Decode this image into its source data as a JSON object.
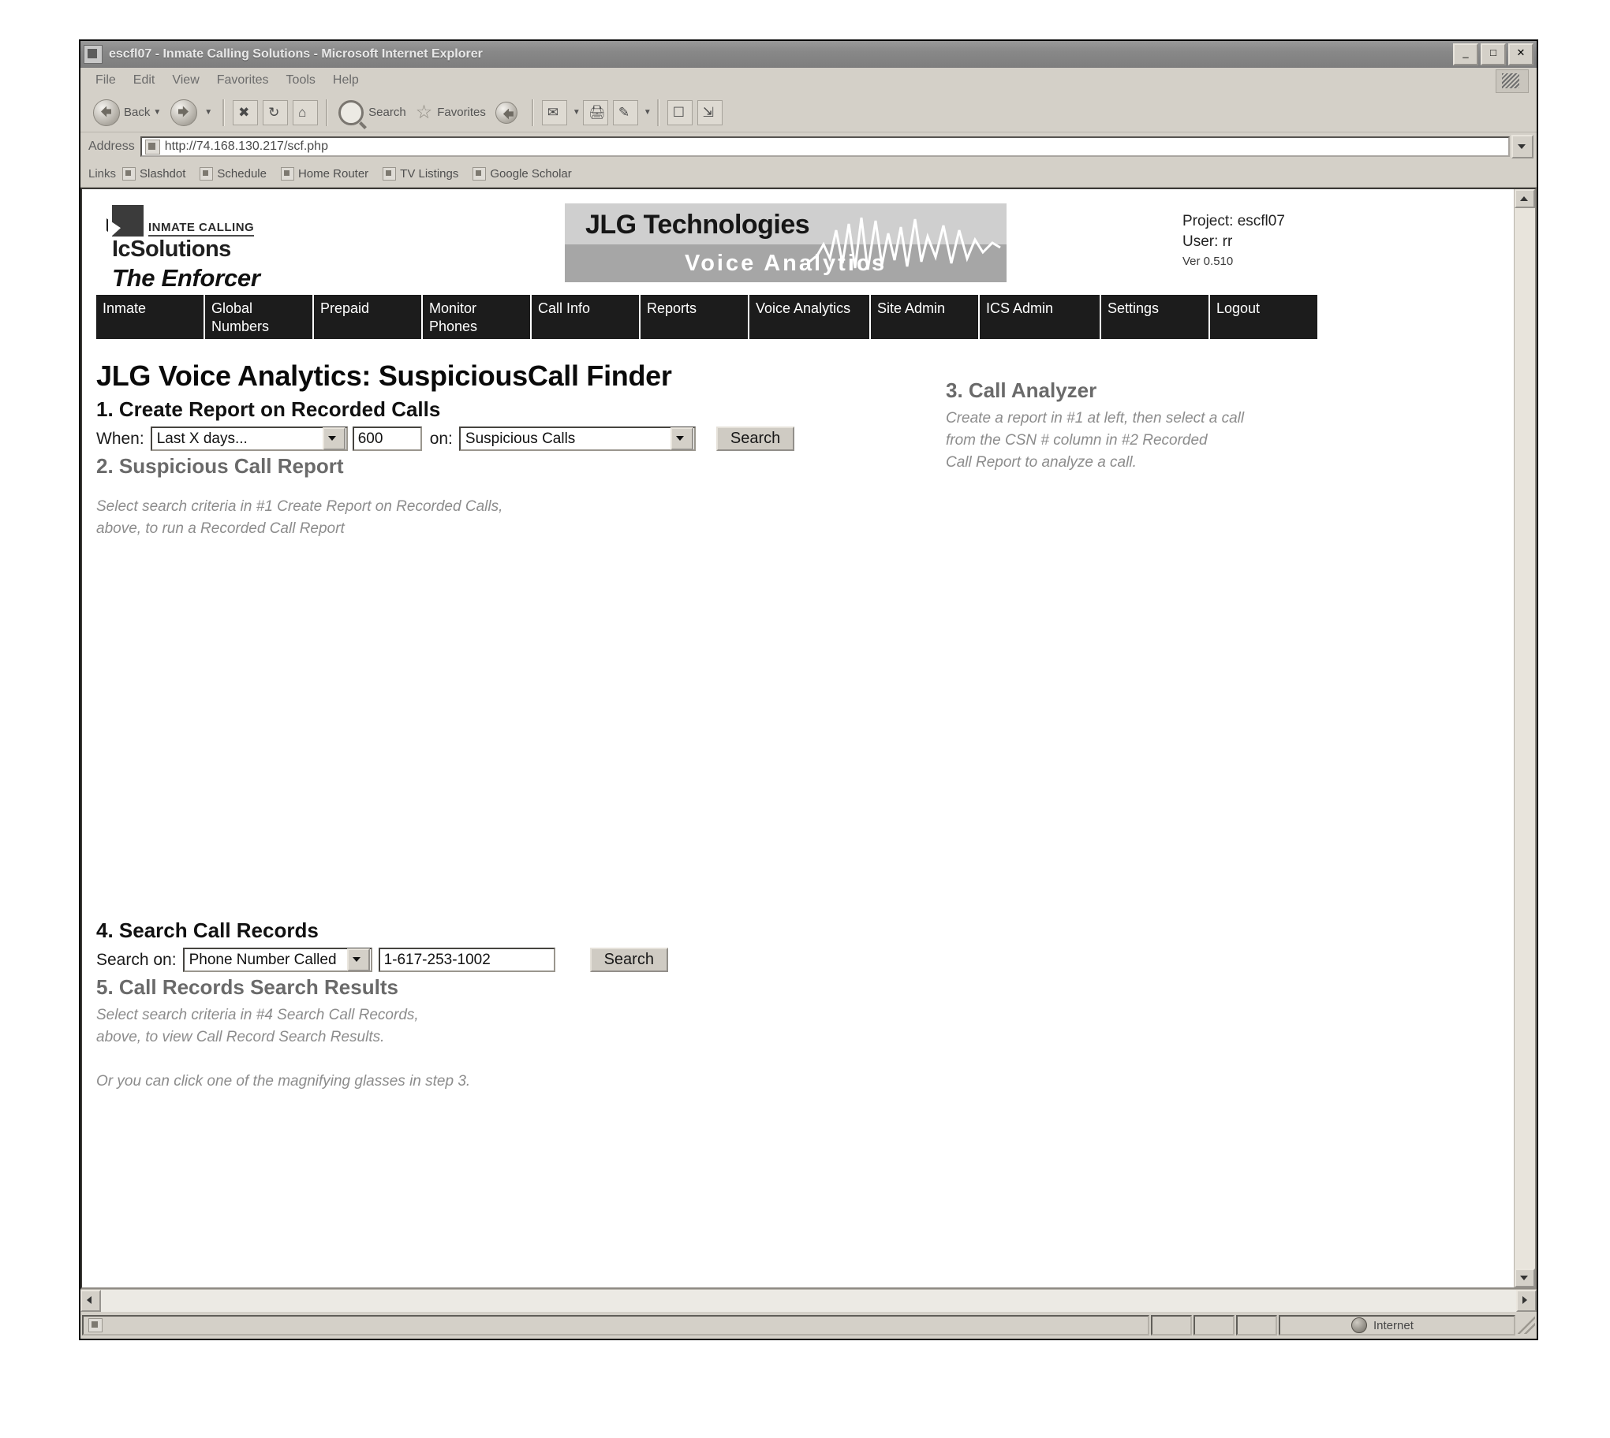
{
  "window": {
    "title": "escfl07 - Inmate Calling Solutions - Microsoft Internet Explorer",
    "minimize_label": "_",
    "maximize_label": "□",
    "close_label": "✕"
  },
  "menubar": {
    "items": [
      "File",
      "Edit",
      "View",
      "Favorites",
      "Tools",
      "Help"
    ]
  },
  "toolbar": {
    "back_label": "Back",
    "forward_label": "",
    "search_label": "Search",
    "favorites_label": "Favorites"
  },
  "address": {
    "label": "Address",
    "value": "http://74.168.130.217/scf.php"
  },
  "links": {
    "label": "Links",
    "items": [
      "Slashdot",
      "Schedule",
      "Home Router",
      "TV Listings",
      "Google Scholar"
    ]
  },
  "brand": {
    "inmate_calling": "INMATE CALLING",
    "ics_solutions": "IcSolutions",
    "enforcer": "The Enforcer"
  },
  "banner": {
    "title_prefix": "JLG",
    "title_suffix": "Technologies",
    "subtitle": "Voice Analytics"
  },
  "project": {
    "project_line": "Project: escfl07",
    "user_line": "User: rr",
    "version_line": "Ver 0.510"
  },
  "nav": {
    "items": [
      "Inmate",
      "Global Numbers",
      "Prepaid",
      "Monitor Phones",
      "Call Info",
      "Reports",
      "Voice Analytics",
      "Site Admin",
      "ICS Admin",
      "Settings",
      "Logout"
    ]
  },
  "page": {
    "heading_prefix": "JLG Voice Analytics: ",
    "heading_strong": "SuspiciousCall Finder",
    "section1": {
      "title": "1. Create Report on Recorded Calls",
      "when_label": "When:",
      "when_value": "Last X days...",
      "days_value": "600",
      "on_label": "on:",
      "on_value": "Suspicious Calls",
      "search_label": "Search"
    },
    "section2": {
      "title": "2. Suspicious Call Report",
      "note_line1": "Select search criteria in #1 Create Report on Recorded Calls,",
      "note_line2": "above, to run a Recorded Call Report"
    },
    "section3": {
      "title": "3. Call Analyzer",
      "note_line1": "Create a report in #1 at left, then select a call",
      "note_line2": "from the CSN # column in #2 Recorded",
      "note_line3": "Call Report to analyze a call."
    },
    "section4": {
      "title": "4. Search Call Records",
      "search_on_label": "Search on:",
      "search_on_value": "Phone Number Called",
      "query_value": "1-617-253-1002",
      "search_label": "Search"
    },
    "section5": {
      "title": "5. Call Records Search Results",
      "note_line1": "Select search criteria in #4 Search Call Records,",
      "note_line2": "above, to view Call Record Search Results.",
      "note_line3": "Or you can click one of the magnifying glasses in step 3."
    }
  },
  "statusbar": {
    "zone_label": "Internet"
  },
  "colors": {
    "chrome": "#d4d0c8",
    "nav_bg": "#1c1c1c",
    "banner_top": "#cfcfcf",
    "banner_bottom": "#a6a6a6",
    "note_text": "#8c8c8c"
  }
}
